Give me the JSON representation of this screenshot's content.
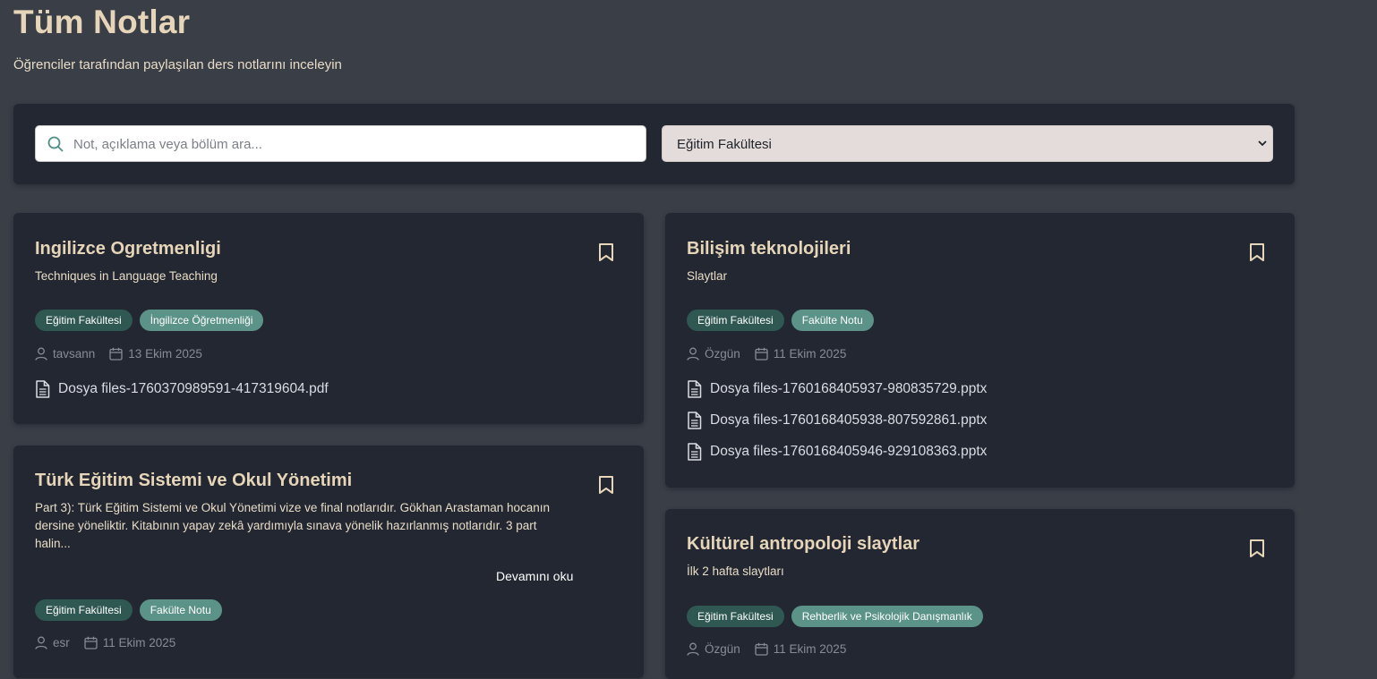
{
  "header": {
    "title": "Tüm Notlar",
    "subtitle": "Öğrenciler tarafından paylaşılan ders notlarını inceleyin"
  },
  "filters": {
    "search_placeholder": "Not, açıklama veya bölüm ara...",
    "search_value": "",
    "faculty_selected": "Eğitim Fakültesi"
  },
  "icons": {
    "search": "search-icon",
    "bookmark": "bookmark-icon",
    "user": "user-icon",
    "calendar": "calendar-icon",
    "file": "file-icon",
    "chevron": "chevron-down-icon"
  },
  "colors": {
    "background": "#393e47",
    "card": "#222731",
    "title": "#e6d5b8",
    "tag_faculty": "#2f5853",
    "tag_dept": "#5b9388"
  },
  "notes": [
    {
      "title": "Ingilizce Ogretmenligi",
      "description": "Techniques in Language Teaching",
      "tags": [
        "Eğitim Fakültesi",
        "İngilizce Öğretmenliği"
      ],
      "author": "tavsann",
      "date": "13 Ekim 2025",
      "files": [
        "Dosya files-1760370989591-417319604.pdf"
      ]
    },
    {
      "title": "Bilişim teknolojileri",
      "description": "Slaytlar",
      "tags": [
        "Eğitim Fakültesi",
        "Fakülte Notu"
      ],
      "author": "Özgün",
      "date": "11 Ekim 2025",
      "files": [
        "Dosya files-1760168405937-980835729.pptx",
        "Dosya files-1760168405938-807592861.pptx",
        "Dosya files-1760168405946-929108363.pptx"
      ]
    },
    {
      "title": "Türk Eğitim Sistemi ve Okul Yönetimi",
      "description": "Part 3): Türk Eğitim Sistemi ve Okul Yönetimi vize ve final notlarıdır. Gökhan Arastaman hocanın dersine yöneliktir. Kitabının yapay zekâ yardımıyla sınava yönelik hazırlanmış notlarıdır. 3 part halin...",
      "read_more": "Devamını oku",
      "tags": [
        "Eğitim Fakültesi",
        "Fakülte Notu"
      ],
      "author": "esr",
      "date": "11 Ekim 2025",
      "files": []
    },
    {
      "title": "Kültürel antropoloji slaytlar",
      "description": "İlk 2 hafta slaytları",
      "tags": [
        "Eğitim Fakültesi",
        "Rehberlik ve Psikolojik Danışmanlık"
      ],
      "author": "Özgün",
      "date": "11 Ekim 2025",
      "files": []
    }
  ]
}
